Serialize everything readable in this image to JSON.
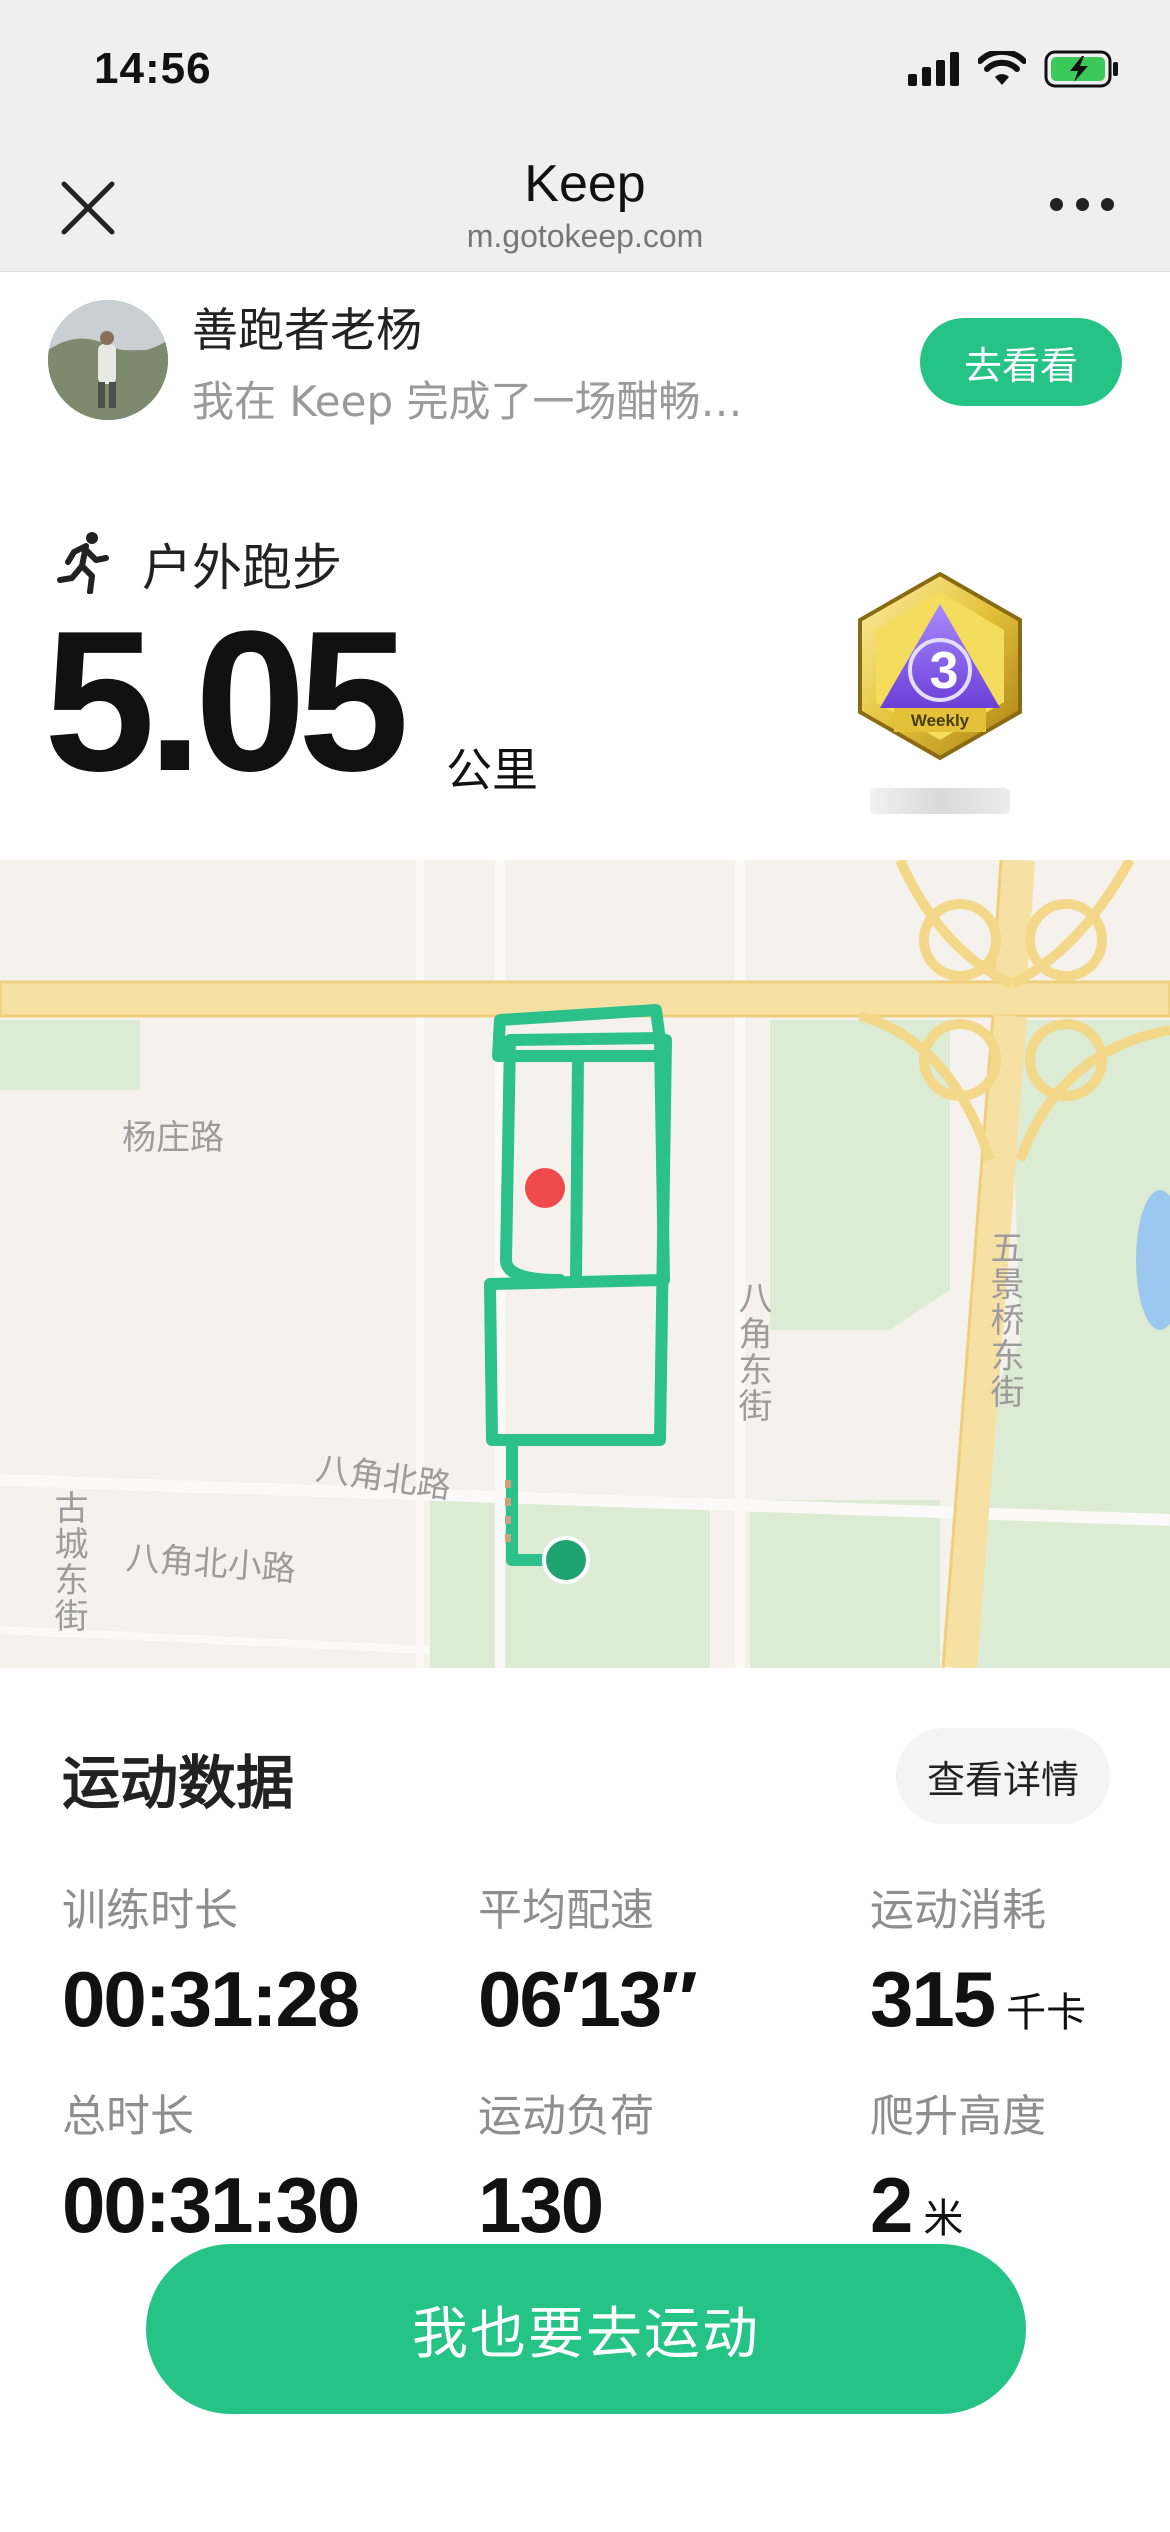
{
  "status_bar": {
    "time": "14:56"
  },
  "header": {
    "title": "Keep",
    "url": "m.gotokeep.com"
  },
  "share": {
    "user_name": "善跑者老杨",
    "message": "我在 Keep 完成了一场酣畅…",
    "go_button": "去看看"
  },
  "activity": {
    "type": "户外跑步",
    "distance": "5.05",
    "unit": "公里",
    "medal_text": "Weekly",
    "medal_number": "3"
  },
  "map": {
    "labels": {
      "yangzhuang_rd": "杨庄路",
      "bajiao_east": "八角东街",
      "wujingqiao_east": "五景桥东街",
      "bajiao_north": "八角北路",
      "gucheng_east": "古城东街",
      "bajiao_north_small": "八角北小路"
    }
  },
  "stats": {
    "title": "运动数据",
    "detail_button": "查看详情",
    "items": [
      {
        "label": "训练时长",
        "value": "00:31:28",
        "unit": ""
      },
      {
        "label": "平均配速",
        "value": "06′13″",
        "unit": ""
      },
      {
        "label": "运动消耗",
        "value": "315",
        "unit": "千卡"
      },
      {
        "label": "总时长",
        "value": "00:31:30",
        "unit": ""
      },
      {
        "label": "运动负荷",
        "value": "130",
        "unit": ""
      },
      {
        "label": "爬升高度",
        "value": "2",
        "unit": "米"
      }
    ]
  },
  "cta": {
    "label": "我也要去运动"
  },
  "colors": {
    "brand_green": "#26c386",
    "route_green": "#2cc18a",
    "start_red": "#ef4b4b"
  }
}
